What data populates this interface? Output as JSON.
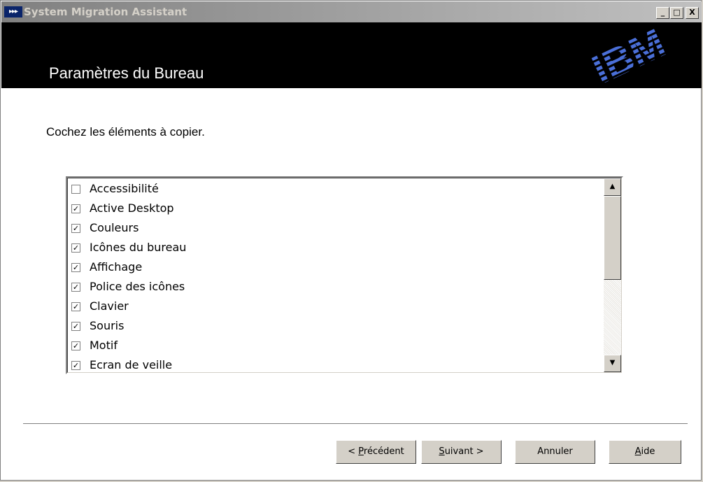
{
  "window": {
    "title": "System Migration Assistant",
    "app_icon": "▸▸▸",
    "minimize": "_",
    "maximize": "□",
    "close": "X"
  },
  "banner": {
    "title": "Paramètres du Bureau",
    "logo": "IBM"
  },
  "instruction": "Cochez les éléments à copier.",
  "list": {
    "items": [
      {
        "label": "Accessibilité",
        "checked": false
      },
      {
        "label": "Active Desktop",
        "checked": true
      },
      {
        "label": "Couleurs",
        "checked": true
      },
      {
        "label": "Icônes du bureau",
        "checked": true
      },
      {
        "label": "Affichage",
        "checked": true
      },
      {
        "label": "Police des icônes",
        "checked": true
      },
      {
        "label": "Clavier",
        "checked": true
      },
      {
        "label": "Souris",
        "checked": true
      },
      {
        "label": "Motif",
        "checked": true
      },
      {
        "label": "Ecran de veille",
        "checked": true
      }
    ]
  },
  "buttons": {
    "previous": {
      "before": "< ",
      "accel": "P",
      "after": "récédent"
    },
    "next": {
      "accel": "S",
      "after": "uivant >"
    },
    "cancel": "Annuler",
    "help": {
      "accel": "A",
      "after": "ide"
    }
  }
}
